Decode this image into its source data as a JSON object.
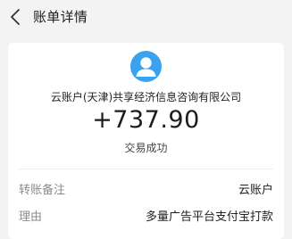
{
  "header": {
    "title": "账单详情",
    "back_icon": "chevron-left-icon"
  },
  "merchant": {
    "avatar_icon": "user-avatar-icon",
    "name": "云账户(天津)共享经济信息咨询有限公司"
  },
  "transaction": {
    "amount": "+737.90",
    "status": "交易成功"
  },
  "details": [
    {
      "label": "转账备注",
      "value": "云账户"
    },
    {
      "label": "理由",
      "value": "多量广告平台支付宝打款"
    }
  ],
  "colors": {
    "background": "#f3f3f3",
    "card": "#ffffff",
    "avatar": "#3ba2f0",
    "label_gray": "#8a8a8a"
  }
}
